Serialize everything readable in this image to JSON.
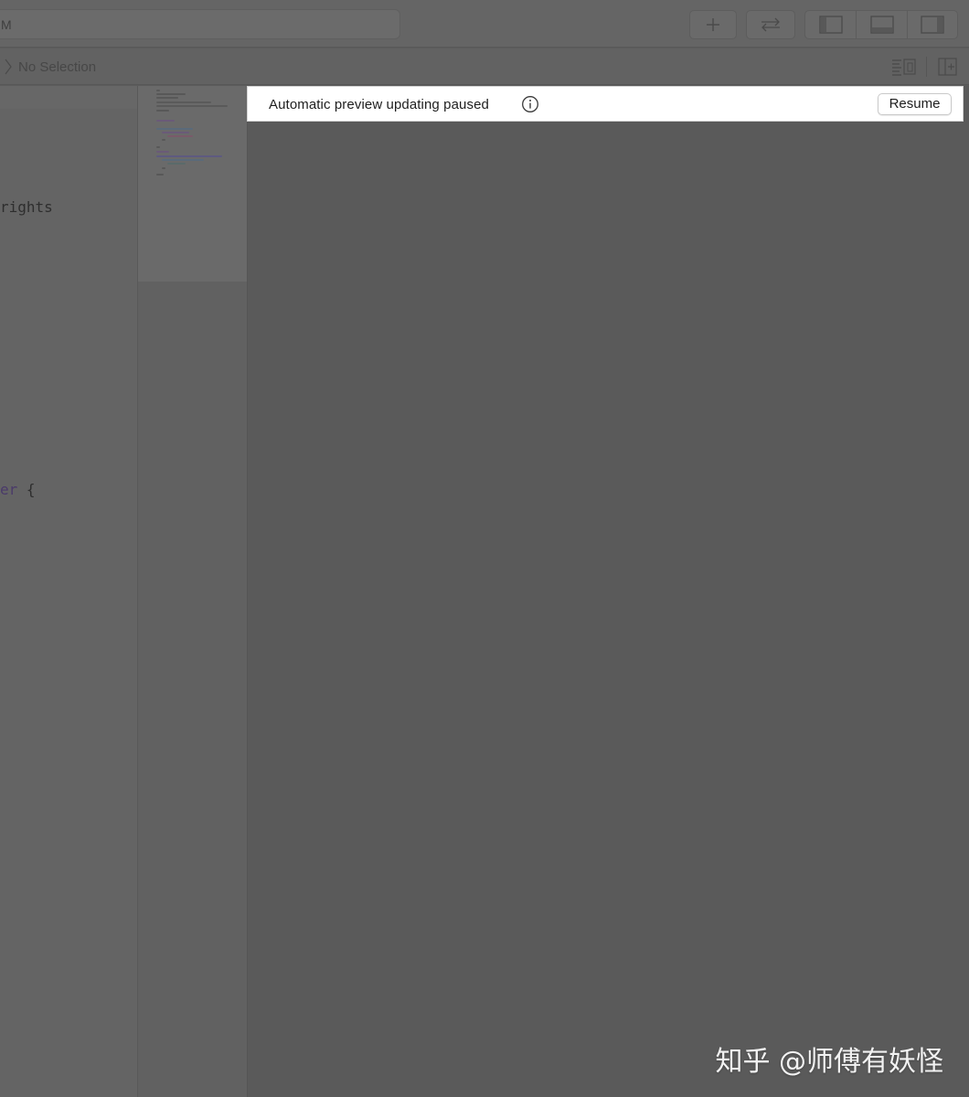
{
  "toolbar": {
    "scheme_text": "M",
    "buttons": [
      {
        "name": "add-button",
        "icon": "plus-icon"
      },
      {
        "name": "back-forward-button",
        "icon": "swap-arrows-icon"
      },
      {
        "name": "toggle-navigator-button",
        "icon": "left-panel-icon"
      },
      {
        "name": "toggle-debug-area-button",
        "icon": "bottom-panel-icon"
      },
      {
        "name": "toggle-inspector-button",
        "icon": "right-panel-icon"
      }
    ]
  },
  "jumpbar": {
    "selection": "No Selection"
  },
  "editor": {
    "lines": {
      "rights": "rights",
      "struct_tail": "er {"
    }
  },
  "preview": {
    "banner_message": "Automatic preview updating paused",
    "resume_label": "Resume"
  },
  "watermark": {
    "text": "知乎 @师傅有妖怪"
  },
  "colors": {
    "dim_overlay": "#5a5a5a",
    "banner_background": "#ffffff",
    "keyword_purple": "#4a3a6a"
  }
}
